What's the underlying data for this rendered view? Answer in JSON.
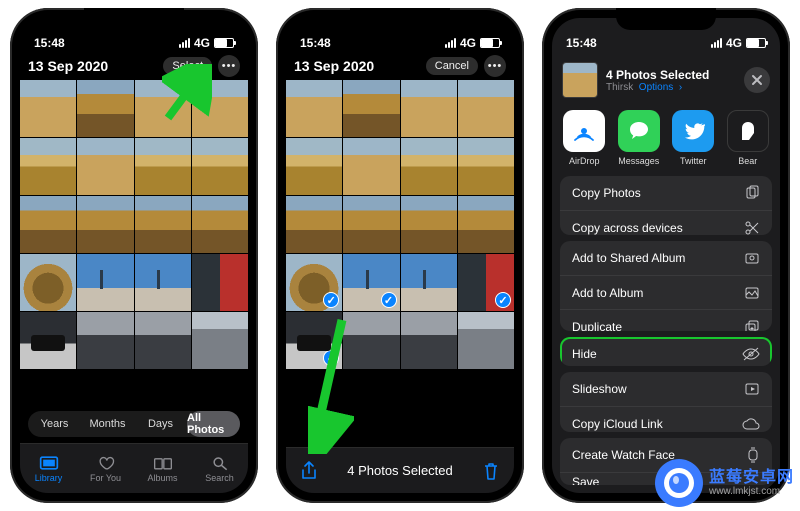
{
  "status": {
    "time": "15:48",
    "network": "4G"
  },
  "screen1": {
    "date": "13 Sep 2020",
    "select": "Select",
    "segments": [
      "Years",
      "Months",
      "Days",
      "All Photos"
    ],
    "tabs": [
      "Library",
      "For You",
      "Albums",
      "Search"
    ]
  },
  "screen2": {
    "date": "13 Sep 2020",
    "cancel": "Cancel",
    "selected_msg": "4 Photos Selected"
  },
  "screen3": {
    "title": "4 Photos Selected",
    "subtitle_loc": "Thirsk",
    "options": "Options",
    "apps": [
      {
        "name": "AirDrop"
      },
      {
        "name": "Messages"
      },
      {
        "name": "Twitter"
      },
      {
        "name": "Bear"
      }
    ],
    "group1": [
      "Copy Photos",
      "Copy across devices"
    ],
    "group2": [
      "Add to Shared Album",
      "Add to Album",
      "Duplicate"
    ],
    "hide": "Hide",
    "group3": [
      "Slideshow",
      "Copy iCloud Link"
    ],
    "group4": [
      "Create Watch Face",
      "Save"
    ]
  },
  "watermark": {
    "cn": "蓝莓安卓网",
    "url": "www.lmkjst.com"
  }
}
